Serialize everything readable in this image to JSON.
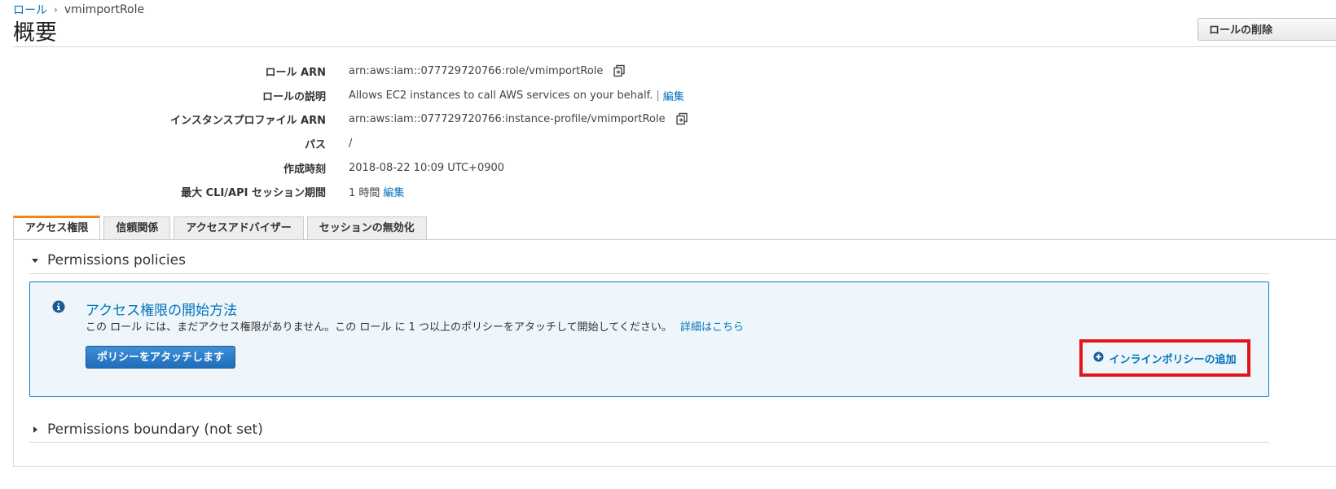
{
  "breadcrumb": {
    "parent": "ロール",
    "current": "vmimportRole"
  },
  "page": {
    "title": "概要",
    "delete_button": "ロールの削除"
  },
  "summary": {
    "role_arn": {
      "label": "ロール ARN",
      "value": "arn:aws:iam::077729720766:role/vmimportRole"
    },
    "description": {
      "label": "ロールの説明",
      "value": "Allows EC2 instances to call AWS services on your behalf.",
      "separator": "|",
      "edit": "編集"
    },
    "instance_profile": {
      "label": "インスタンスプロファイル ARN",
      "value": "arn:aws:iam::077729720766:instance-profile/vmimportRole"
    },
    "path": {
      "label": "パス",
      "value": "/"
    },
    "created": {
      "label": "作成時刻",
      "value": "2018-08-22 10:09 UTC+0900"
    },
    "max_session": {
      "label": "最大 CLI/API セッション期間",
      "value": "1 時間",
      "edit": "編集"
    }
  },
  "tabs": [
    {
      "label": "アクセス権限",
      "active": true
    },
    {
      "label": "信頼関係",
      "active": false
    },
    {
      "label": "アクセスアドバイザー",
      "active": false
    },
    {
      "label": "セッションの無効化",
      "active": false
    }
  ],
  "permissions_policies": {
    "header": "Permissions policies",
    "expanded": true,
    "info": {
      "title": "アクセス権限の開始方法",
      "text": "この ロール には、まだアクセス権限がありません。この ロール に 1 つ以上のポリシーをアタッチして開始してください。",
      "more_link": "詳細はこちら",
      "attach_button": "ポリシーをアタッチします",
      "add_inline": "インラインポリシーの追加"
    }
  },
  "permissions_boundary": {
    "header": "Permissions boundary (not set)",
    "expanded": false
  },
  "colors": {
    "link": "#0073bb",
    "active_tab_accent": "#e88b1b",
    "info_border": "#0f7bc1",
    "info_background": "#eef6fb",
    "primary_button": "#1f6dbb",
    "highlight": "#e4141b"
  },
  "icons": {
    "breadcrumb_separator": "chevron-right-icon",
    "copy": "copy-icon",
    "info": "info-circle-icon",
    "expanded": "caret-down-icon",
    "collapsed": "caret-right-icon",
    "add": "plus-circle-icon"
  }
}
